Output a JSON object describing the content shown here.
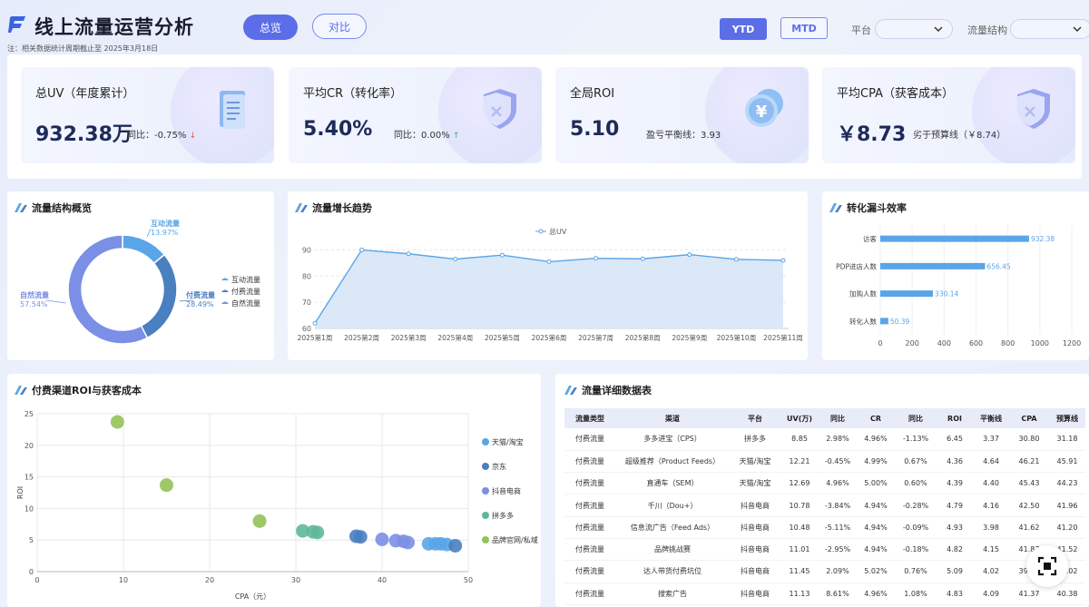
{
  "header": {
    "title": "线上流量运营分析",
    "note": "注：相关数据统计周期截止至 2025年3月18日",
    "tabs": [
      "总览",
      "对比"
    ],
    "period_tabs": [
      "YTD",
      "MTD"
    ],
    "filters": [
      {
        "label": "平台",
        "value": ""
      },
      {
        "label": "流量结构",
        "value": ""
      }
    ]
  },
  "kpis": [
    {
      "label": "总UV（年度累计）",
      "value": "932.38万",
      "sub": "同比：-0.75%",
      "trend": "down",
      "icon": "document-icon"
    },
    {
      "label": "平均CR（转化率）",
      "value": "5.40%",
      "sub": "同比：0.00%",
      "trend": "up",
      "icon": "shield-icon"
    },
    {
      "label": "全局ROI",
      "value": "5.10",
      "sub": "盈亏平衡线：3.93",
      "trend": "",
      "icon": "yen-coin-icon"
    },
    {
      "label": "平均CPA（获客成本）",
      "value": "￥8.73",
      "sub": "劣于预算线（￥8.74）",
      "trend": "",
      "icon": "shield-icon"
    }
  ],
  "colors": {
    "accent": "#5b6ee8",
    "pos": "#2fae5e",
    "neg": "#e04545"
  },
  "donut": {
    "title": "流量结构概览",
    "chart_data": {
      "type": "pie",
      "slices": [
        {
          "name": "互动流量",
          "value": 13.97,
          "label": "13.97%",
          "color": "#5aa5e8"
        },
        {
          "name": "付费流量",
          "value": 28.49,
          "label": "28.49%",
          "color": "#4a7fc0"
        },
        {
          "name": "自然流量",
          "value": 57.54,
          "label": "57.54%",
          "color": "#7b8fe6"
        }
      ],
      "legend": [
        "互动流量",
        "付费流量",
        "自然流量"
      ]
    }
  },
  "trend": {
    "title": "流量增长趋势",
    "chart_data": {
      "type": "area",
      "legend": "总UV",
      "categories": [
        "2025第1周",
        "2025第2周",
        "2025第3周",
        "2025第4周",
        "2025第5周",
        "2025第6周",
        "2025第7周",
        "2025第8周",
        "2025第9周",
        "2025第10周",
        "2025第11周"
      ],
      "values": [
        62,
        90,
        88.5,
        86.5,
        88,
        85.5,
        86.8,
        86.6,
        88.2,
        86.4,
        86
      ],
      "yticks": [
        60,
        70,
        80,
        90
      ],
      "ylim": [
        60,
        95
      ]
    }
  },
  "funnel": {
    "title": "转化漏斗效率",
    "chart_data": {
      "type": "bar",
      "categories": [
        "访客",
        "PDP进店人数",
        "加购人数",
        "转化人数"
      ],
      "values": [
        932.38,
        656.45,
        330.14,
        50.39
      ],
      "xticks": [
        0,
        200,
        400,
        600,
        800,
        1000,
        1200
      ],
      "xlim": [
        0,
        1200
      ]
    }
  },
  "scatter": {
    "title": "付费渠道ROI与获客成本",
    "chart_data": {
      "type": "scatter",
      "xlabel": "CPA（元）",
      "ylabel": "ROI",
      "xticks": [
        0,
        10,
        20,
        30,
        40,
        50
      ],
      "yticks": [
        0,
        5,
        10,
        15,
        20,
        25
      ],
      "xlim": [
        0,
        50
      ],
      "ylim": [
        0,
        25
      ],
      "series": [
        {
          "name": "天猫/淘宝",
          "color": "#5aa5e8",
          "points": [
            [
              46.2,
              4.4
            ],
            [
              45.4,
              4.4
            ],
            [
              46.8,
              4.4
            ],
            [
              47.5,
              4.3
            ]
          ]
        },
        {
          "name": "京东",
          "color": "#4a7fc0",
          "points": [
            [
              37.0,
              5.6
            ],
            [
              37.5,
              5.5
            ],
            [
              48.5,
              4.1
            ]
          ]
        },
        {
          "name": "抖音电商",
          "color": "#7b8fe6",
          "points": [
            [
              42.5,
              4.8
            ],
            [
              41.6,
              4.9
            ],
            [
              40.0,
              5.1
            ],
            [
              43.0,
              4.6
            ]
          ]
        },
        {
          "name": "拼多多",
          "color": "#5fb89a",
          "points": [
            [
              30.8,
              6.45
            ],
            [
              32.0,
              6.3
            ],
            [
              32.5,
              6.2
            ]
          ]
        },
        {
          "name": "品牌官网/私域",
          "color": "#94c25a",
          "points": [
            [
              9.3,
              23.7
            ],
            [
              15.0,
              13.7
            ],
            [
              25.8,
              8.0
            ]
          ]
        }
      ]
    }
  },
  "table": {
    "title": "流量详细数据表",
    "headers": [
      "流量类型",
      "渠道",
      "平台",
      "UV(万)",
      "同比",
      "CR",
      "同比",
      "ROI",
      "平衡线",
      "CPA",
      "预算线"
    ],
    "rows": [
      [
        "付费流量",
        "多多进宝（CPS）",
        "拼多多",
        "8.85",
        "2.98%",
        "4.96%",
        "-1.13%",
        "6.45",
        "3.37",
        "30.80",
        "31.18"
      ],
      [
        "付费流量",
        "超级推荐（Product Feeds）",
        "天猫/淘宝",
        "12.21",
        "-0.45%",
        "4.99%",
        "0.67%",
        "4.36",
        "4.64",
        "46.21",
        "45.91"
      ],
      [
        "付费流量",
        "直通车（SEM）",
        "天猫/淘宝",
        "12.69",
        "4.96%",
        "5.00%",
        "0.60%",
        "4.39",
        "4.40",
        "45.43",
        "44.23"
      ],
      [
        "付费流量",
        "千川（Dou+）",
        "抖音电商",
        "10.78",
        "-3.84%",
        "4.94%",
        "-0.28%",
        "4.79",
        "4.16",
        "42.50",
        "41.96"
      ],
      [
        "付费流量",
        "信息流广告（Feed Ads）",
        "抖音电商",
        "10.48",
        "-5.11%",
        "4.94%",
        "-0.09%",
        "4.93",
        "3.98",
        "41.62",
        "41.20"
      ],
      [
        "付费流量",
        "品牌挑战赛",
        "抖音电商",
        "11.01",
        "-2.95%",
        "4.94%",
        "-0.18%",
        "4.82",
        "4.15",
        "41.87",
        "41.52"
      ],
      [
        "付费流量",
        "达人带货付费坑位",
        "抖音电商",
        "11.45",
        "2.09%",
        "5.02%",
        "0.76%",
        "5.09",
        "4.02",
        "39.96",
        "40.02"
      ],
      [
        "付费流量",
        "搜索广告",
        "抖音电商",
        "11.13",
        "8.61%",
        "4.96%",
        "1.08%",
        "4.83",
        "4.09",
        "41.37",
        "40.38"
      ]
    ]
  }
}
